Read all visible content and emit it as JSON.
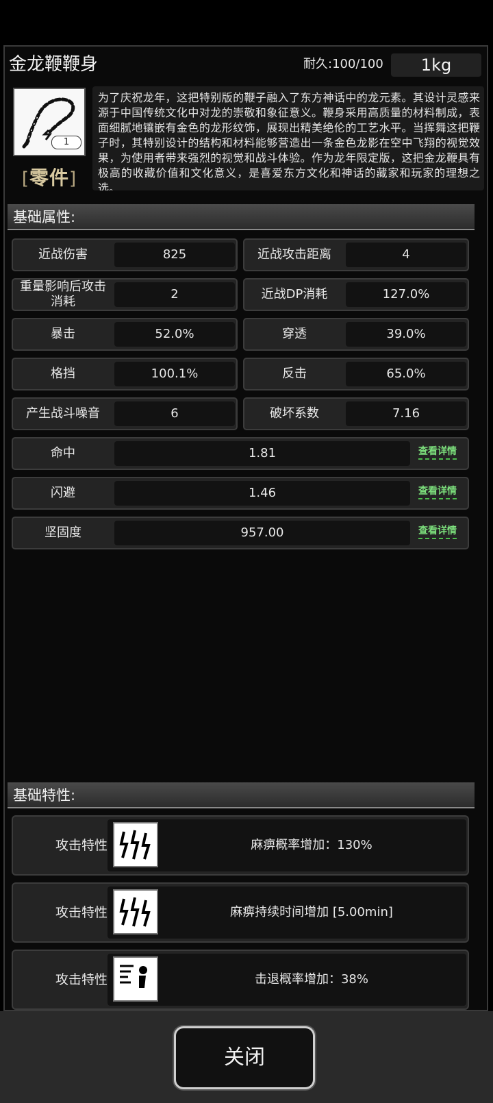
{
  "item": {
    "name": "金龙鞭鞭身",
    "durability": "耐久:100/100",
    "weight": "1kg",
    "count": "1",
    "category": "零件",
    "category_open": "[",
    "category_close": "]",
    "description": "为了庆祝龙年，这把特别版的鞭子融入了东方神话中的龙元素。其设计灵感来源于中国传统文化中对龙的崇敬和象征意义。鞭身采用高质量的材料制成，表面细腻地镶嵌有金色的龙形纹饰，展现出精美绝伦的工艺水平。当挥舞这把鞭子时，其特别设计的结构和材料能够营造出一条金色龙影在空中飞翔的视觉效果，为使用者带来强烈的视觉和战斗体验。作为龙年限定版，这把金龙鞭具有极高的收藏价值和文化意义，是喜爱东方文化和神话的藏家和玩家的理想之选。",
    "icon": "whip-icon"
  },
  "sections": {
    "base_attributes": "基础属性:",
    "base_traits": "基础特性:"
  },
  "stats_pairs": [
    [
      {
        "label": "近战伤害",
        "value": "825"
      },
      {
        "label": "近战攻击距离",
        "value": "4"
      }
    ],
    [
      {
        "label": "重量影响后攻击消耗",
        "value": "2"
      },
      {
        "label": "近战DP消耗",
        "value": "127.0%"
      }
    ],
    [
      {
        "label": "暴击",
        "value": "52.0%"
      },
      {
        "label": "穿透",
        "value": "39.0%"
      }
    ],
    [
      {
        "label": "格挡",
        "value": "100.1%"
      },
      {
        "label": "反击",
        "value": "65.0%"
      }
    ],
    [
      {
        "label": "产生战斗噪音",
        "value": "6"
      },
      {
        "label": "破坏系数",
        "value": "7.16"
      }
    ]
  ],
  "stats_full": [
    {
      "label": "命中",
      "value": "1.81",
      "link": "查看详情"
    },
    {
      "label": "闪避",
      "value": "1.46",
      "link": "查看详情"
    },
    {
      "label": "坚固度",
      "value": "957.00",
      "link": "查看详情"
    }
  ],
  "traits": [
    {
      "label": "攻击特性",
      "text": "麻痹概率增加：130%",
      "icon": "lightning-icon"
    },
    {
      "label": "攻击特性",
      "text": "麻痹持续时间增加 [5.00min]",
      "icon": "lightning-icon"
    },
    {
      "label": "攻击特性",
      "text": "击退概率增加：38%",
      "icon": "knockback-icon"
    }
  ],
  "close_label": "关闭",
  "colors": {
    "link": "#7de07d",
    "panel": "#0a0a0a",
    "cell": "#242424"
  }
}
